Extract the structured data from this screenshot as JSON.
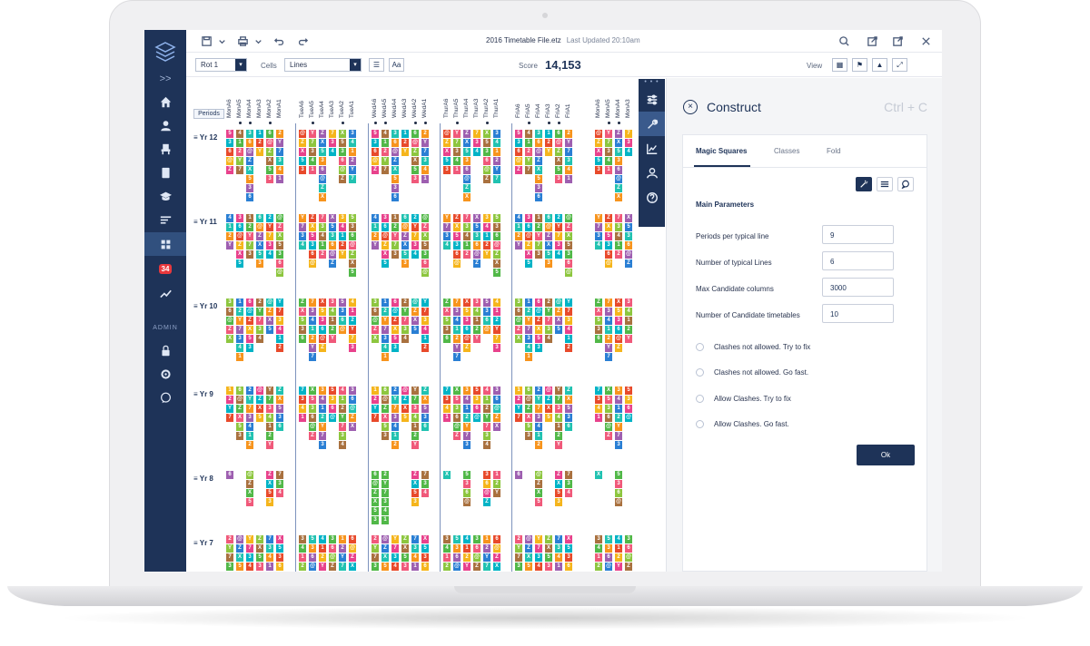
{
  "window": {
    "title": "2016 Timetable File.etz",
    "last_updated": "Last Updated 20:10am"
  },
  "toolbar": {
    "rot_select": "Rot 1",
    "cells_label": "Cells",
    "cells_select": "Lines",
    "score_label": "Score",
    "score_value": "14,153",
    "view_label": "View"
  },
  "nav": {
    "collapse_label": ">>",
    "badge_count": "34",
    "admin_label": "ADMIN"
  },
  "grid": {
    "periods_button": "Periods",
    "column_headers": [
      "MonA6",
      "MonA5",
      "MonA4",
      "MonA3",
      "MonA2",
      "MonA1",
      "TueA6",
      "TueA5",
      "TueA4",
      "TueA3",
      "TueA2",
      "TueA1",
      "WedA6",
      "WedA5",
      "WedA4",
      "WedA3",
      "WedA2",
      "WedA1",
      "ThurA6",
      "ThurA5",
      "ThurA4",
      "ThurA3",
      "ThurA2",
      "ThurA1",
      "FriA6",
      "FriA5",
      "FriA4",
      "FriA3",
      "FriA2",
      "FriA1",
      "MonA6",
      "MonA5",
      "MonA4",
      "MonA3"
    ],
    "year_labels": [
      "Yr 12",
      "Yr 11",
      "Yr 10",
      "Yr 9",
      "Yr 8",
      "Yr 7"
    ]
  },
  "panel": {
    "title": "Construct",
    "shortcut": "Ctrl + C",
    "tabs": [
      "Magic Squares",
      "Classes",
      "Fold"
    ],
    "section_title": "Main Parameters",
    "params": [
      {
        "label": "Periods per typical line",
        "value": "9"
      },
      {
        "label": "Number of typical Lines",
        "value": "6"
      },
      {
        "label": "Max Candidate columns",
        "value": "3000"
      },
      {
        "label": "Number of Candidate timetables",
        "value": "10"
      }
    ],
    "options": [
      "Clashes not allowed. Try to fix",
      "Clashes not allowed. Go fast.",
      "Allow Clashes. Try to fix",
      "Allow Clashes. Go fast."
    ],
    "ok_label": "Ok"
  },
  "colors": {
    "nav_bg": "#1e3358",
    "accent": "#1e3358",
    "badge": "#e8383d",
    "cell_palette": [
      "#e8428c",
      "#f7941d",
      "#8dc63f",
      "#00b3c6",
      "#9e5fb0",
      "#a9713f",
      "#e84a2b",
      "#2a7fd4",
      "#51b848",
      "#f5b51c",
      "#21c2b1",
      "#f0597a"
    ]
  },
  "icons": {
    "nav": [
      "home-icon",
      "user-icon",
      "chair-icon",
      "book-icon",
      "graduation-cap-icon",
      "list-icon",
      "grid-icon",
      "calendar-badge-icon",
      "trend-icon",
      "lock-icon",
      "gear-icon",
      "help-chat-icon"
    ],
    "toolstrip": [
      "sliders-icon",
      "wrench-icon",
      "chart-icon",
      "person-icon",
      "question-icon"
    ],
    "topbar": [
      "save-icon",
      "print-icon",
      "undo-icon",
      "redo-icon",
      "search-icon",
      "export-icon",
      "popout-icon",
      "close-icon"
    ]
  }
}
